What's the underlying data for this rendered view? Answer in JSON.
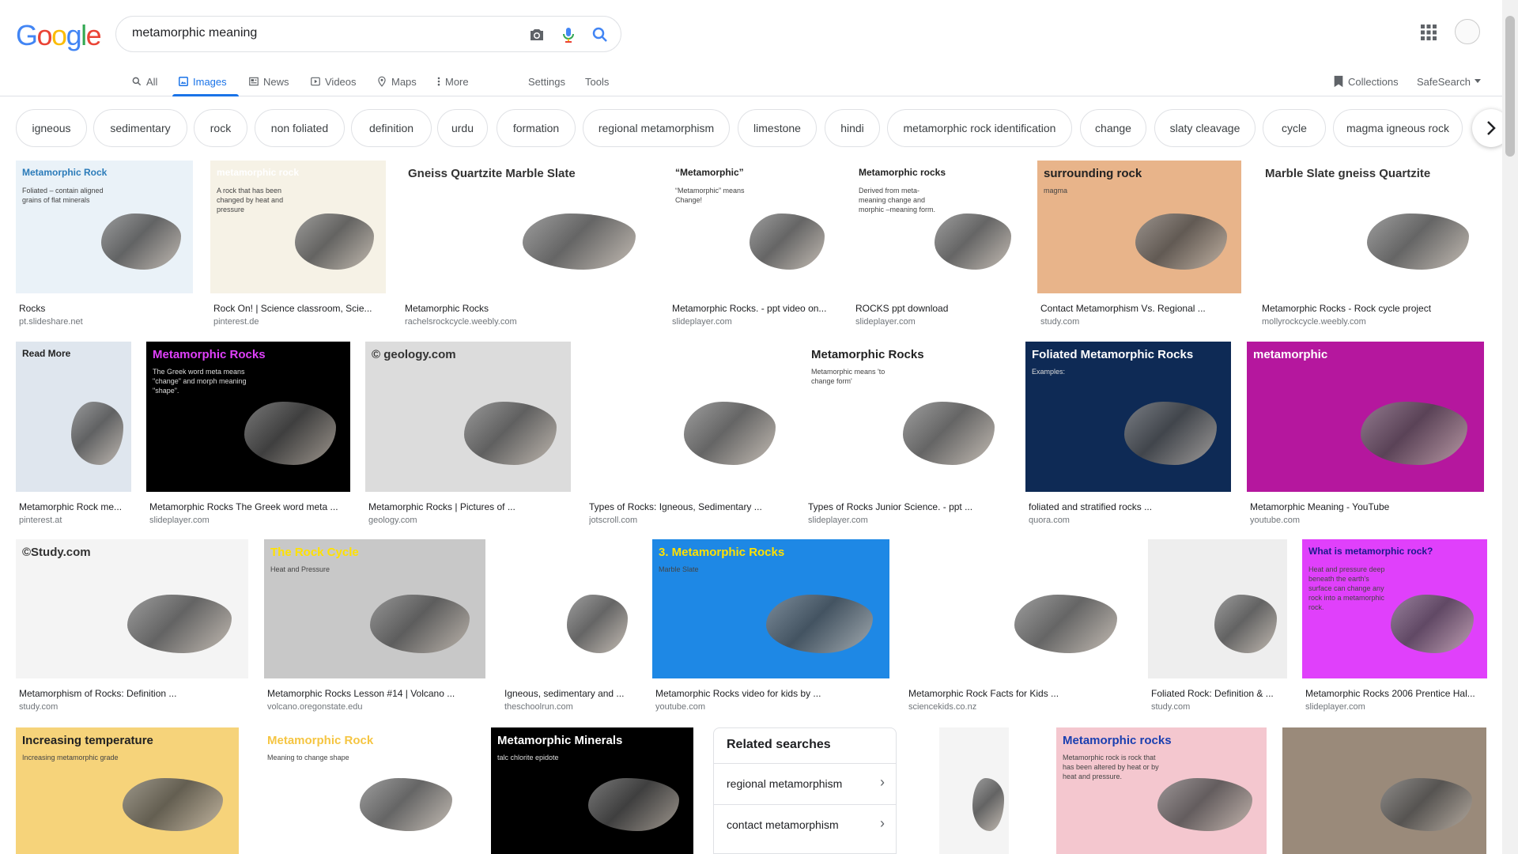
{
  "logo": {
    "letters": [
      "G",
      "o",
      "o",
      "g",
      "l",
      "e"
    ],
    "colors": [
      "#4285f4",
      "#ea4335",
      "#fbbc05",
      "#4285f4",
      "#34a853",
      "#ea4335"
    ]
  },
  "search": {
    "query": "metamorphic meaning"
  },
  "tabs": {
    "all": "All",
    "images": "Images",
    "news": "News",
    "videos": "Videos",
    "maps": "Maps",
    "more": "More",
    "settings": "Settings",
    "tools": "Tools",
    "collections": "Collections",
    "safesearch": "SafeSearch"
  },
  "chips": [
    "igneous",
    "sedimentary",
    "rock",
    "non foliated",
    "definition",
    "urdu",
    "formation",
    "regional metamorphism",
    "limestone",
    "hindi",
    "metamorphic rock identification",
    "change",
    "slaty cleavage",
    "cycle",
    "magma igneous rock"
  ],
  "results": [
    {
      "caption": "Rocks",
      "domain": "pt.slideshare.net",
      "thumb_title": "Metamorphic Rock",
      "thumb_sub": "Foliated – contain aligned grains of flat minerals",
      "bg": "#eaf2f8",
      "fg": "#2b7bb9"
    },
    {
      "caption": "Rock On! | Science classroom, Scie...",
      "domain": "pinterest.de",
      "thumb_title": "metamorphic rock",
      "thumb_sub": "A rock that has been changed by heat and pressure",
      "bg": "#f6f2e6",
      "fg": "#ffffff"
    },
    {
      "caption": "Metamorphic Rocks",
      "domain": "rachelsrockcycle.weebly.com",
      "thumb_title": "Gneiss Quartzite Marble Slate",
      "thumb_sub": "",
      "bg": "#ffffff",
      "fg": "#333333"
    },
    {
      "caption": "Metamorphic Rocks. - ppt video on...",
      "domain": "slideplayer.com",
      "thumb_title": "“Metamorphic”",
      "thumb_sub": "“Metamorphic” means Change!",
      "bg": "#ffffff",
      "fg": "#222222"
    },
    {
      "caption": "ROCKS ppt download",
      "domain": "slideplayer.com",
      "thumb_title": "Metamorphic rocks",
      "thumb_sub": "Derived from meta- meaning change and morphic –meaning form.",
      "bg": "#ffffff",
      "fg": "#222222"
    },
    {
      "caption": "Contact Metamorphism Vs. Regional ...",
      "domain": "study.com",
      "thumb_title": "surrounding rock",
      "thumb_sub": "magma",
      "bg": "#e8b48a",
      "fg": "#222222"
    },
    {
      "caption": "Metamorphic Rocks - Rock cycle project",
      "domain": "mollyrockcycle.weebly.com",
      "thumb_title": "Marble Slate gneiss Quartzite",
      "thumb_sub": "",
      "bg": "#ffffff",
      "fg": "#333333"
    },
    {
      "caption": "Metamorphic Rock me...",
      "domain": "pinterest.at",
      "thumb_title": "Read More",
      "thumb_sub": "",
      "bg": "#dfe6ee",
      "fg": "#222222"
    },
    {
      "caption": "Metamorphic Rocks The Greek word meta ...",
      "domain": "slideplayer.com",
      "thumb_title": "Metamorphic Rocks",
      "thumb_sub": "The Greek word meta means \"change\" and morph meaning \"shape\".",
      "bg": "#000000",
      "fg": "#e040fb"
    },
    {
      "caption": "Metamorphic Rocks | Pictures of ...",
      "domain": "geology.com",
      "thumb_title": "© geology.com",
      "thumb_sub": "",
      "bg": "#dcdcdc",
      "fg": "#333333"
    },
    {
      "caption": "Types of Rocks: Igneous, Sedimentary ...",
      "domain": "jotscroll.com",
      "thumb_title": "",
      "thumb_sub": "",
      "bg": "#ffffff",
      "fg": "#333333"
    },
    {
      "caption": "Types of Rocks Junior Science. - ppt ...",
      "domain": "slideplayer.com",
      "thumb_title": "Metamorphic Rocks",
      "thumb_sub": "Metamorphic means 'to change form'",
      "bg": "#ffffff",
      "fg": "#222222"
    },
    {
      "caption": "foliated and stratified rocks ...",
      "domain": "quora.com",
      "thumb_title": "Foliated Metamorphic Rocks",
      "thumb_sub": "Examples:",
      "bg": "#0e2a55",
      "fg": "#ffffff"
    },
    {
      "caption": "Metamorphic Meaning - YouTube",
      "domain": "youtube.com",
      "thumb_title": "metamorphic",
      "thumb_sub": "",
      "bg": "#b5179e",
      "fg": "#ffffff"
    },
    {
      "caption": "Metamorphism of Rocks: Definition ...",
      "domain": "study.com",
      "thumb_title": "©Study.com",
      "thumb_sub": "",
      "bg": "#f4f4f4",
      "fg": "#333333"
    },
    {
      "caption": "Metamorphic Rocks Lesson #14 | Volcano ...",
      "domain": "volcano.oregonstate.edu",
      "thumb_title": "The Rock Cycle",
      "thumb_sub": "Heat and Pressure",
      "bg": "#c8c8c8",
      "fg": "#ffe100"
    },
    {
      "caption": "Igneous, sedimentary and ...",
      "domain": "theschoolrun.com",
      "thumb_title": "",
      "thumb_sub": "",
      "bg": "#ffffff",
      "fg": "#333333"
    },
    {
      "caption": "Metamorphic Rocks video for kids by ...",
      "domain": "youtube.com",
      "thumb_title": "3. Metamorphic Rocks",
      "thumb_sub": "Marble Slate",
      "bg": "#1e88e5",
      "fg": "#ffe100"
    },
    {
      "caption": "Metamorphic Rock Facts for Kids ...",
      "domain": "sciencekids.co.nz",
      "thumb_title": "",
      "thumb_sub": "",
      "bg": "#ffffff",
      "fg": "#333333"
    },
    {
      "caption": "Foliated Rock: Definition & ...",
      "domain": "study.com",
      "thumb_title": "",
      "thumb_sub": "",
      "bg": "#eeeeee",
      "fg": "#333333"
    },
    {
      "caption": "Metamorphic Rocks 2006 Prentice Hal...",
      "domain": "slideplayer.com",
      "thumb_title": "What is metamorphic rock?",
      "thumb_sub": "Heat and pressure deep beneath the earth's surface can change any rock into a metamorphic rock.",
      "bg": "#e040fb",
      "fg": "#1a1a8c"
    },
    {
      "caption": "",
      "domain": "",
      "thumb_title": "Increasing temperature",
      "thumb_sub": "Increasing metamorphic grade",
      "bg": "#f6d37a",
      "fg": "#222222"
    },
    {
      "caption": "",
      "domain": "",
      "thumb_title": "Metamorphic Rock",
      "thumb_sub": "Meaning to change shape",
      "bg": "#ffffff",
      "fg": "#f5c542"
    },
    {
      "caption": "",
      "domain": "",
      "thumb_title": "Metamorphic Minerals",
      "thumb_sub": "talc chlorite epidote",
      "bg": "#000000",
      "fg": "#ffffff"
    },
    {
      "caption": "",
      "domain": "",
      "thumb_title": "",
      "thumb_sub": "",
      "bg": "#f4f4f4",
      "fg": "#333333"
    },
    {
      "caption": "",
      "domain": "",
      "thumb_title": "Metamorphic rocks",
      "thumb_sub": "Metamorphic rock is rock that has been altered by heat or by heat and pressure.",
      "bg": "#f4c7cf",
      "fg": "#1a3fb0"
    },
    {
      "caption": "",
      "domain": "",
      "thumb_title": "",
      "thumb_sub": "",
      "bg": "#9a8a7a",
      "fg": "#333333"
    }
  ],
  "related": {
    "title": "Related searches",
    "items": [
      "regional metamorphism",
      "contact metamorphism"
    ]
  }
}
